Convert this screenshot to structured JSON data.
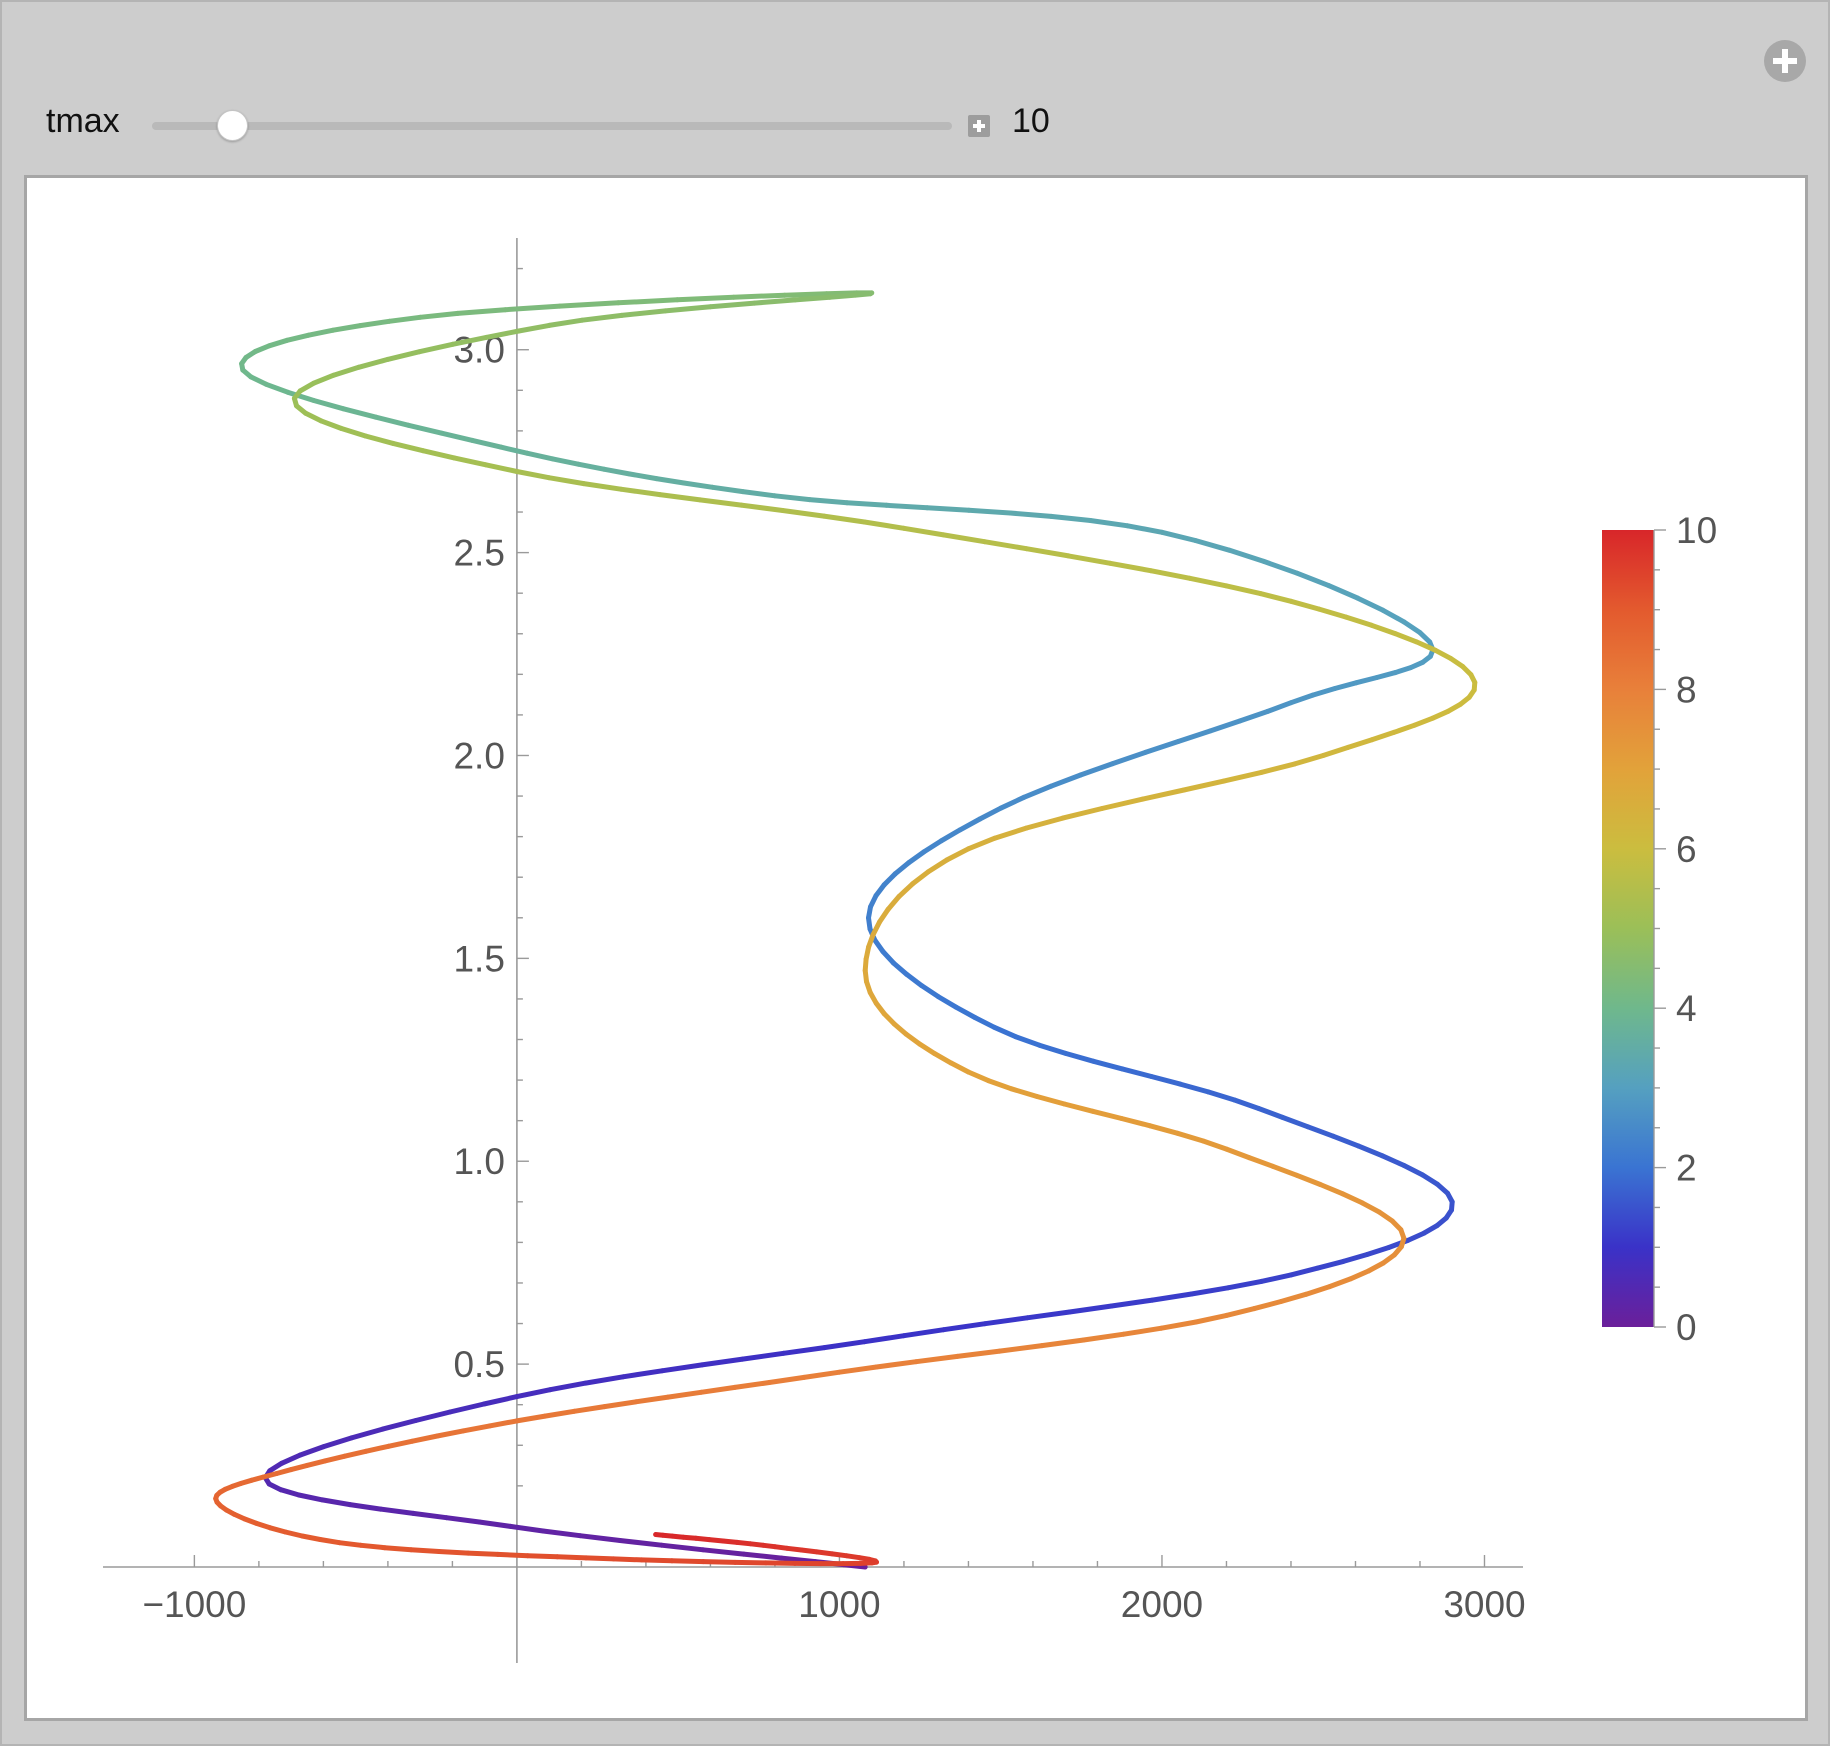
{
  "control": {
    "label": "tmax",
    "value": "10",
    "value_num": 10,
    "min": 0,
    "max": 100
  },
  "chart_data": {
    "type": "line",
    "title": "",
    "xlabel": "",
    "ylabel": "",
    "xlim": [
      -1150,
      3200
    ],
    "ylim": [
      0,
      3.3
    ],
    "x_ticks": [
      -1000,
      1000,
      2000,
      3000
    ],
    "x_tick_labels": [
      "−1000",
      "1000",
      "2000",
      "3000"
    ],
    "y_ticks": [
      0.5,
      1.0,
      1.5,
      2.0,
      2.5,
      3.0
    ],
    "y_tick_labels": [
      "0.5",
      "1.0",
      "1.5",
      "2.0",
      "2.5",
      "3.0"
    ],
    "grid": false,
    "colorbar": {
      "range": [
        0,
        10
      ],
      "ticks": [
        0,
        2,
        4,
        6,
        8,
        10
      ],
      "tick_labels": [
        "0",
        "2",
        "4",
        "6",
        "8",
        "10"
      ],
      "colors": [
        "#6b1f9a",
        "#3a32c8",
        "#3a74d2",
        "#55a0c0",
        "#6fb88c",
        "#9bbf58",
        "#cbbd3f",
        "#e2a23a",
        "#e8803a",
        "#e35a2e",
        "#d8262a"
      ]
    },
    "series": [
      {
        "param": "t",
        "color_by": "t",
        "points": [
          {
            "t": 0.0,
            "x": 1080,
            "y": 0.0
          },
          {
            "t": 0.25,
            "x": -20,
            "y": 0.1
          },
          {
            "t": 0.5,
            "x": -780,
            "y": 0.22
          },
          {
            "t": 0.75,
            "x": 0,
            "y": 0.42
          },
          {
            "t": 1.0,
            "x": 1200,
            "y": 0.57
          },
          {
            "t": 1.25,
            "x": 2400,
            "y": 0.72
          },
          {
            "t": 1.5,
            "x": 2900,
            "y": 0.9
          },
          {
            "t": 1.75,
            "x": 2300,
            "y": 1.13
          },
          {
            "t": 2.0,
            "x": 1480,
            "y": 1.33
          },
          {
            "t": 2.25,
            "x": 1090,
            "y": 1.6
          },
          {
            "t": 2.5,
            "x": 1500,
            "y": 1.87
          },
          {
            "t": 2.75,
            "x": 2400,
            "y": 2.13
          },
          {
            "t": 3.0,
            "x": 2830,
            "y": 2.28
          },
          {
            "t": 3.25,
            "x": 2000,
            "y": 2.55
          },
          {
            "t": 3.5,
            "x": 800,
            "y": 2.64
          },
          {
            "t": 3.75,
            "x": -50,
            "y": 2.76
          },
          {
            "t": 4.0,
            "x": -850,
            "y": 2.95
          },
          {
            "t": 4.25,
            "x": -300,
            "y": 3.08
          },
          {
            "t": 4.5,
            "x": 1100,
            "y": 3.14
          },
          {
            "t": 4.75,
            "x": 100,
            "y": 3.06
          },
          {
            "t": 5.0,
            "x": -690,
            "y": 2.88
          },
          {
            "t": 5.25,
            "x": 0,
            "y": 2.7
          },
          {
            "t": 5.5,
            "x": 1200,
            "y": 2.56
          },
          {
            "t": 5.75,
            "x": 2400,
            "y": 2.38
          },
          {
            "t": 6.0,
            "x": 2970,
            "y": 2.18
          },
          {
            "t": 6.25,
            "x": 2500,
            "y": 2.0
          },
          {
            "t": 6.5,
            "x": 1400,
            "y": 1.77
          },
          {
            "t": 6.75,
            "x": 1080,
            "y": 1.47
          },
          {
            "t": 7.0,
            "x": 1400,
            "y": 1.22
          },
          {
            "t": 7.25,
            "x": 2200,
            "y": 1.03
          },
          {
            "t": 7.5,
            "x": 2750,
            "y": 0.81
          },
          {
            "t": 7.75,
            "x": 2200,
            "y": 0.62
          },
          {
            "t": 8.0,
            "x": 1000,
            "y": 0.48
          },
          {
            "t": 8.25,
            "x": 0,
            "y": 0.36
          },
          {
            "t": 8.5,
            "x": -700,
            "y": 0.24
          },
          {
            "t": 8.75,
            "x": -930,
            "y": 0.16
          },
          {
            "t": 9.0,
            "x": -550,
            "y": 0.06
          },
          {
            "t": 9.25,
            "x": 300,
            "y": 0.02
          },
          {
            "t": 9.5,
            "x": 1100,
            "y": 0.01
          },
          {
            "t": 9.75,
            "x": 800,
            "y": 0.05
          },
          {
            "t": 10.0,
            "x": 430,
            "y": 0.08
          }
        ]
      }
    ]
  }
}
